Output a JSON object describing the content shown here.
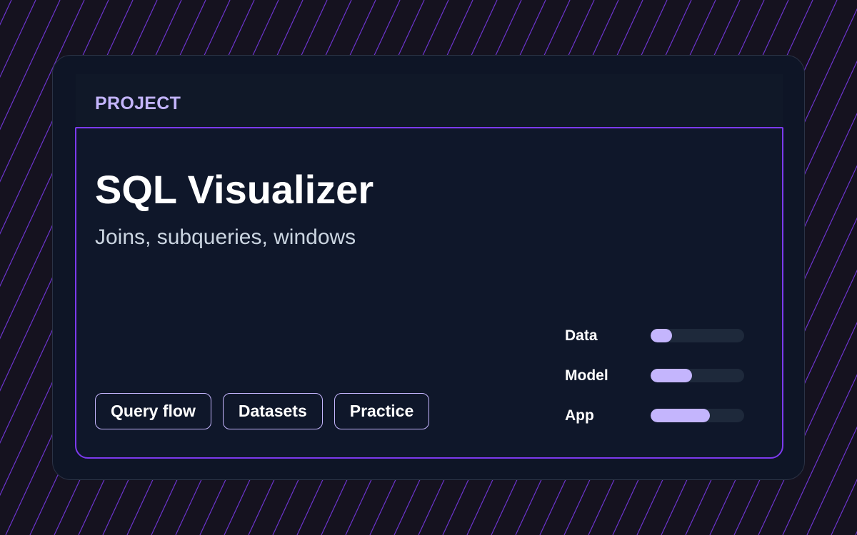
{
  "card": {
    "eyebrow": "PROJECT",
    "title": "SQL Visualizer",
    "subtitle": "Joins, subqueries, windows"
  },
  "tags": [
    {
      "label": "Query flow"
    },
    {
      "label": "Datasets"
    },
    {
      "label": "Practice"
    }
  ],
  "progress": [
    {
      "label": "Data",
      "fraction": 0.23
    },
    {
      "label": "Model",
      "fraction": 0.44
    },
    {
      "label": "App",
      "fraction": 0.63
    }
  ],
  "colors": {
    "background": "#15121f",
    "stripe": "#7c3aed",
    "card": "#0e1526",
    "accent": "#7c3aed",
    "accent_light": "#c4b5fd",
    "track": "#1e293b"
  }
}
